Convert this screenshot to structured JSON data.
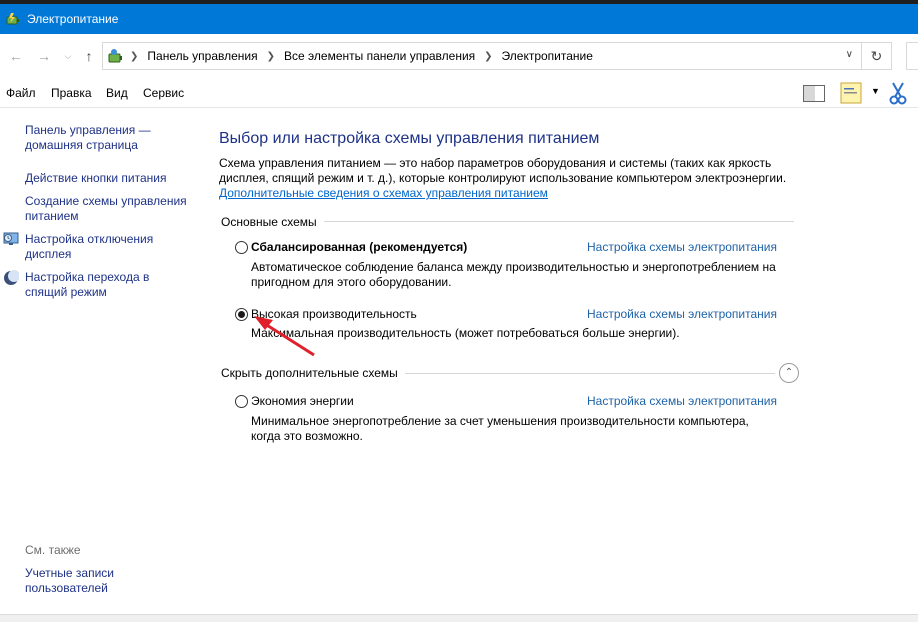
{
  "window": {
    "title": "Электропитание"
  },
  "breadcrumb": [
    "Панель управления",
    "Все элементы панели управления",
    "Электропитание"
  ],
  "menu": [
    "Файл",
    "Правка",
    "Вид",
    "Сервис"
  ],
  "left_nav": {
    "home_link": "Панель управления — домашняя страница",
    "power_button": "Действие кнопки питания",
    "create_plan": "Создание схемы управления питанием",
    "display_off": "Настройка отключения дисплея",
    "sleep": "Настройка перехода в спящий режим",
    "see_also_label": "См. также",
    "user_accounts": "Учетные записи пользователей"
  },
  "main": {
    "title": "Выбор или настройка схемы управления питанием",
    "description": "Схема управления питанием — это набор параметров оборудования и системы (таких как яркость дисплея, спящий режим и т. д.), которые контролируют использование компьютером электроэнергии.",
    "more_info_link": "Дополнительные сведения о схемах управления питанием",
    "basic_group_label": "Основные схемы",
    "additional_group_label": "Скрыть дополнительные схемы",
    "plans": [
      {
        "name": "Сбалансированная (рекомендуется)",
        "description": "Автоматическое соблюдение баланса между производительностью и энергопотреблением на пригодном для этого оборудовании.",
        "link": "Настройка схемы электропитания",
        "selected": false
      },
      {
        "name": "Высокая производительность",
        "description": "Максимальная производительность (может потребоваться больше энергии).",
        "link": "Настройка схемы электропитания",
        "selected": true
      },
      {
        "name": "Экономия энергии",
        "description": "Минимальное энергопотребление за счет уменьшения производительности компьютера, когда это возможно.",
        "link": "Настройка схемы электропитания",
        "selected": false
      }
    ]
  },
  "colors": {
    "titlebar": "#0078d7",
    "link": "#1e3287",
    "annotation_arrow": "#e0202a"
  },
  "icons": {
    "app": "power-options-icon",
    "back": "arrow-left-icon",
    "forward": "arrow-right-icon",
    "up": "arrow-up-icon",
    "refresh": "refresh-icon",
    "cut": "scissors-icon"
  }
}
